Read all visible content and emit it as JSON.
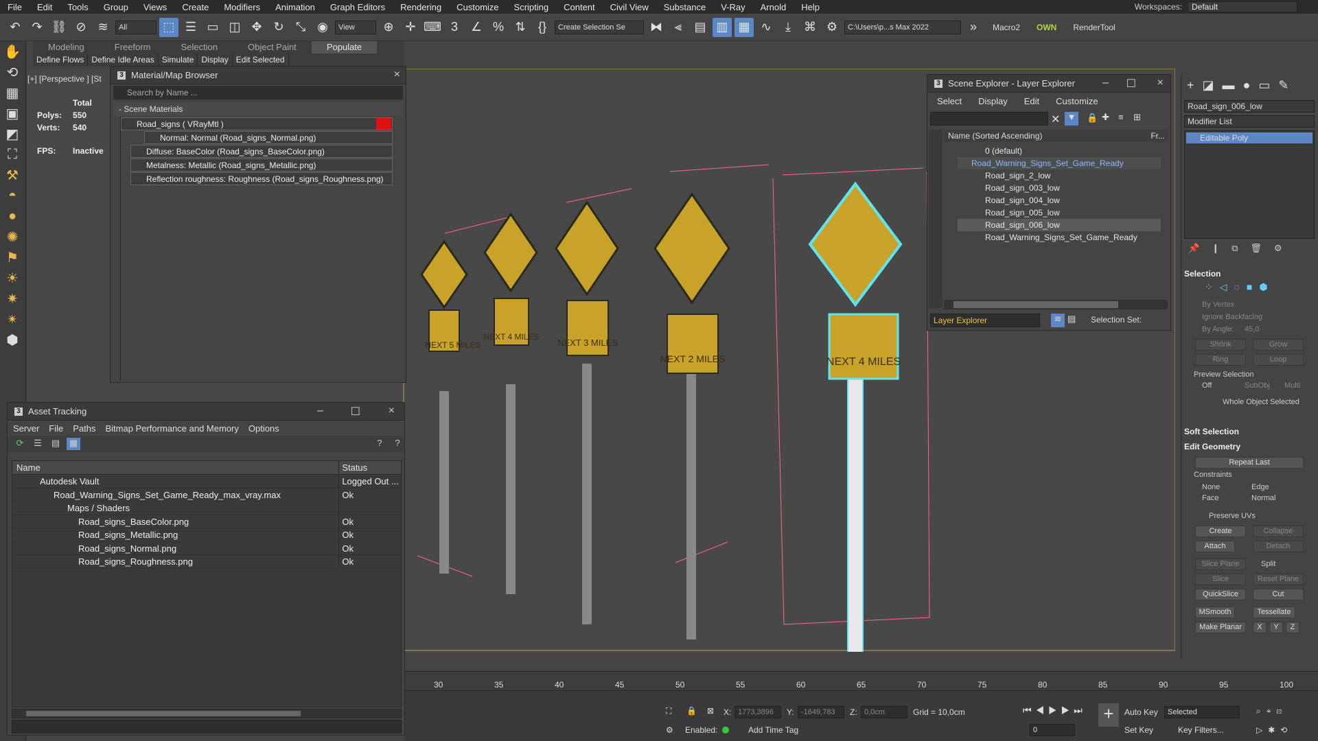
{
  "menu": [
    "File",
    "Edit",
    "Tools",
    "Group",
    "Views",
    "Create",
    "Modifiers",
    "Animation",
    "Graph Editors",
    "Rendering",
    "Customize",
    "Scripting",
    "Content",
    "Civil View",
    "Substance",
    "V-Ray",
    "Arnold",
    "Help"
  ],
  "workspaces": {
    "label": "Workspaces:",
    "value": "Default"
  },
  "toolbar": {
    "filter_all": "All",
    "view_dd": "View",
    "selection_set": "Create Selection Se",
    "path": "C:\\Users\\p...s Max 2022",
    "macro": "Macro2",
    "own": "OWN",
    "rendertool": "RenderTool"
  },
  "ribbon_tabs": [
    "Modeling",
    "Freeform",
    "Selection",
    "Object Paint",
    "Populate"
  ],
  "ribbon_sub": [
    "Define Flows",
    "Define Idle Areas",
    "Simulate",
    "Display",
    "Edit Selected"
  ],
  "viewport": {
    "label": "[+] [Perspective ] [St",
    "stats": {
      "total": "Total",
      "polys_label": "Polys:",
      "polys": "550",
      "verts_label": "Verts:",
      "verts": "540",
      "fps_label": "FPS:",
      "fps": "Inactive"
    }
  },
  "material_browser": {
    "title": "Material/Map Browser",
    "search": "Search by Name ...",
    "section": "- Scene Materials",
    "items": [
      "Road_signs  ( VRayMtl )",
      "Normal: Normal (Road_signs_Normal.png)",
      "Diffuse: BaseColor (Road_signs_BaseColor.png)",
      "Metalness: Metallic (Road_signs_Metallic.png)",
      "Reflection roughness: Roughness (Road_signs_Roughness.png)"
    ]
  },
  "asset_tracking": {
    "title": "Asset Tracking",
    "menu": [
      "Server",
      "File",
      "Paths",
      "Bitmap Performance and Memory",
      "Options"
    ],
    "headers": {
      "name": "Name",
      "status": "Status"
    },
    "rows": [
      {
        "name": "Autodesk Vault",
        "status": "Logged Out ..."
      },
      {
        "name": "Road_Warning_Signs_Set_Game_Ready_max_vray.max",
        "status": "Ok"
      },
      {
        "name": "Maps / Shaders",
        "status": ""
      },
      {
        "name": "Road_signs_BaseColor.png",
        "status": "Ok"
      },
      {
        "name": "Road_signs_Metallic.png",
        "status": "Ok"
      },
      {
        "name": "Road_signs_Normal.png",
        "status": "Ok"
      },
      {
        "name": "Road_signs_Roughness.png",
        "status": "Ok"
      }
    ]
  },
  "scene_explorer": {
    "title": "Scene Explorer - Layer Explorer",
    "menu": [
      "Select",
      "Display",
      "Edit",
      "Customize"
    ],
    "column": "Name (Sorted Ascending)",
    "col2": "Fr...",
    "rows": [
      "0 (default)",
      "Road_Warning_Signs_Set_Game_Ready",
      "Road_sign_2_low",
      "Road_sign_003_low",
      "Road_sign_004_low",
      "Road_sign_005_low",
      "Road_sign_006_low",
      "Road_Warning_Signs_Set_Game_Ready"
    ],
    "footer_dd": "Layer Explorer",
    "selection_set": "Selection Set:"
  },
  "command_panel": {
    "object_name": "Road_sign_006_low",
    "modifier_list": "Modifier List",
    "modifier": "Editable Poly",
    "selection": "Selection",
    "by_vertex": "By Vertex",
    "ignore_backfacing": "Ignore Backfacing",
    "by_angle": "By Angle:",
    "angle_val": "45,0",
    "shrink": "Shrink",
    "grow": "Grow",
    "ring": "Ring",
    "loop": "Loop",
    "preview_selection": "Preview Selection",
    "off": "Off",
    "subobj": "SubObj",
    "multi": "Multi",
    "whole_object": "Whole Object Selected",
    "soft_selection": "Soft Selection",
    "edit_geometry": "Edit Geometry",
    "repeat_last": "Repeat Last",
    "constraints": "Constraints",
    "none": "None",
    "edge": "Edge",
    "face": "Face",
    "normal": "Normal",
    "preserve_uvs": "Preserve UVs",
    "create": "Create",
    "collapse": "Collapse",
    "attach": "Attach",
    "detach": "Detach",
    "slice_plane": "Slice Plane",
    "split": "Split",
    "slice": "Slice",
    "reset_plane": "Reset Plane",
    "quickslice": "QuickSlice",
    "cut": "Cut",
    "msmooth": "MSmooth",
    "tessellate": "Tessellate",
    "make_planar": "Make Planar",
    "x": "X",
    "y": "Y",
    "z": "Z"
  },
  "timeline": {
    "ticks": [
      "30",
      "35",
      "40",
      "45",
      "50",
      "55",
      "60",
      "65",
      "70",
      "75",
      "80",
      "85",
      "90",
      "95",
      "100"
    ]
  },
  "statusbar": {
    "x_label": "X:",
    "x": "1773,3896",
    "y_label": "Y:",
    "y": "-1649,783",
    "z_label": "Z:",
    "z": "0,0cm",
    "grid": "Grid = 10,0cm",
    "enabled": "Enabled:",
    "add_time_tag": "Add Time Tag",
    "auto_key": "Auto Key",
    "selected": "Selected",
    "set_key": "Set Key",
    "key_filters": "Key Filters...",
    "frame": "0"
  },
  "signs": [
    "NEXT 5 MILES",
    "NEXT 4 MILES",
    "NEXT 3 MILES",
    "NEXT 2 MILES",
    "NEXT 4 MILES"
  ],
  "colors": {
    "accent": "#5b87c4",
    "sign_yellow": "#c9a22a",
    "selection": "#5fe4f0",
    "wire": "#ff6680"
  }
}
